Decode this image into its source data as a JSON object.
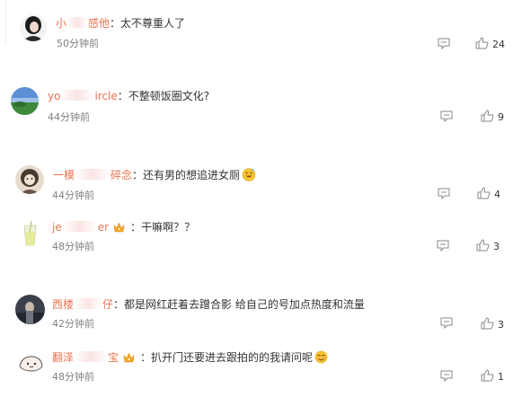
{
  "comments": [
    {
      "user_start": "小",
      "user_end": "感他",
      "separator": "：",
      "text": "太不尊重人了",
      "time": "50分钟前",
      "likes": "24"
    },
    {
      "user_start": "yo",
      "user_end": "ircle",
      "separator": "：",
      "text": "不整顿饭圈文化?",
      "time": "44分钟前",
      "likes": "9"
    },
    {
      "user_start": "一模",
      "user_end": "碎念",
      "separator": "：",
      "text": "还有男的想追进女厕",
      "time": "44分钟前",
      "likes": "4"
    },
    {
      "user_start": "je",
      "user_end": "er",
      "separator": "：",
      "text": "干嘛啊？？",
      "time": "48分钟前",
      "likes": "3"
    },
    {
      "user_start": "西楼",
      "user_end": "仔",
      "separator": "：",
      "text": "都是网红赶着去蹭合影 给自己的号加点热度和流量",
      "time": "42分钟前",
      "likes": "3"
    },
    {
      "user_start": "翻泽",
      "user_end": "宝",
      "separator": "：",
      "text": "扒开门还要进去跟拍的的我请问呢",
      "time": "48分钟前",
      "likes": "1"
    }
  ],
  "colors": {
    "username": "#eb7350",
    "text": "#333333",
    "time": "#808080",
    "icon": "#888888"
  },
  "icons": {
    "reply": "comment-icon",
    "like": "thumbs-up-icon",
    "badge": "crown-badge-icon",
    "emoji_sweat": "sweat-smile-emoji",
    "emoji_blush": "blush-emoji"
  }
}
